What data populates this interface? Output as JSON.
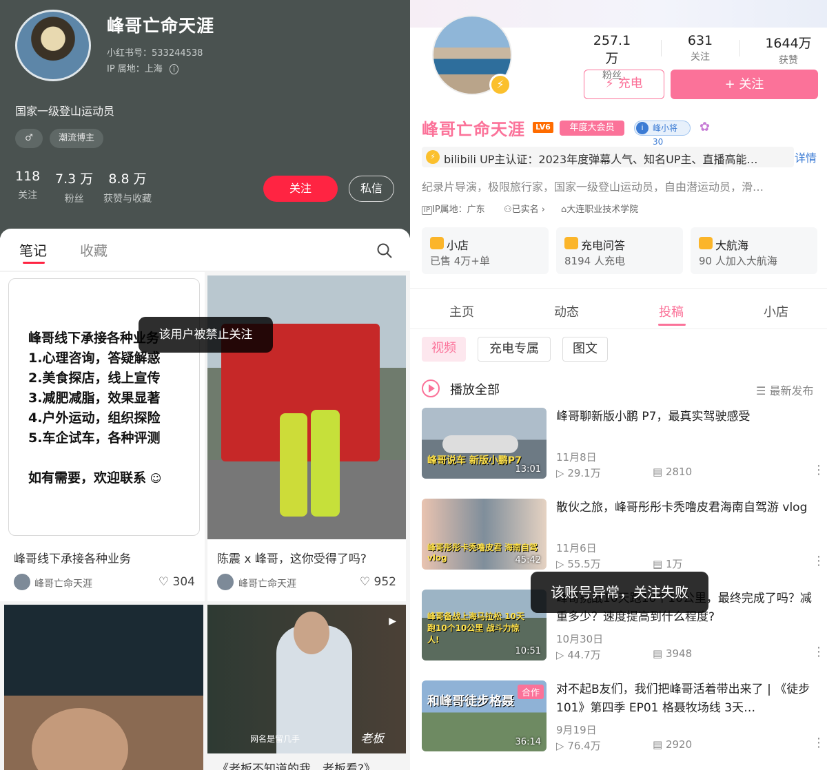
{
  "left": {
    "profile": {
      "name": "峰哥亡命天涯",
      "id_line": "小红书号：533244538",
      "ip_line": "IP 属地：上海",
      "bio": "国家一级登山运动员",
      "tags": [
        "♂",
        "潮流博主"
      ],
      "stats": [
        {
          "value": "118",
          "label": "关注"
        },
        {
          "value": "7.3 万",
          "label": "粉丝"
        },
        {
          "value": "8.8 万",
          "label": "获赞与收藏"
        }
      ],
      "follow_label": "关注",
      "message_label": "私信"
    },
    "tabs": [
      "笔记",
      "收藏"
    ],
    "notes": [
      {
        "lines": [
          "峰哥线下承接各种业务",
          "1.心理咨询，答疑解惑",
          "2.美食探店，线上宣传",
          "3.减肥减脂，效果显著",
          "4.户外运动，组织探险",
          "5.车企试车，各种评测",
          "",
          "如有需要，欢迎联系"
        ],
        "title": "峰哥线下承接各种业务",
        "author": "峰哥亡命天涯",
        "likes": "304"
      },
      {
        "title": "陈震 x 峰哥，这你受得了吗?",
        "author": "峰哥亡命天涯",
        "likes": "952"
      }
    ],
    "image_caption_2": "网名是留几手",
    "image_caption_2b": "老板",
    "toast": "该用户被禁止关注",
    "bottom_partial_title": "《老板不知道的我，老板看?》"
  },
  "right": {
    "stats": [
      {
        "value": "257.1万",
        "label": "粉丝"
      },
      {
        "value": "631",
        "label": "关注"
      },
      {
        "value": "1644万",
        "label": "获赞"
      }
    ],
    "charge_label": "充电",
    "follow_label": "+ 关注",
    "name": "峰哥亡命天涯",
    "level": "LV6",
    "vip": "年度大会员",
    "medal": "峰小将 30",
    "cert": "bilibili UP主认证：2023年度弹幕人气、知名UP主、直播高能…",
    "cert_more": "详情",
    "bio": "纪录片导演，极限旅行家，国家一级登山运动员，自由潜运动员，滑…",
    "meta": [
      "IP属地：广东",
      "已实名",
      "大连职业技术学院"
    ],
    "boxes": [
      {
        "title": "小店",
        "sub": "已售 4万+单"
      },
      {
        "title": "充电问答",
        "sub": "8194 人充电"
      },
      {
        "title": "大航海",
        "sub": "90 人加入大航海"
      }
    ],
    "tabs": [
      "主页",
      "动态",
      "投稿",
      "小店"
    ],
    "chips": [
      "视频",
      "充电专属",
      "图文"
    ],
    "play_all": "播放全部",
    "sort": "最新发布",
    "videos": [
      {
        "title": "峰哥聊新版小鹏 P7，最真实驾驶感受",
        "date": "11月8日",
        "views": "29.1万",
        "danmaku": "2810",
        "duration": "13:01",
        "overlay": "峰哥说车 新版小鹏P7"
      },
      {
        "title": "散伙之旅，峰哥彤彤卡秃噜皮君海南自驾游 vlog",
        "date": "11月6日",
        "views": "55.5万",
        "danmaku": "1万",
        "duration": "45:42",
        "overlay": "峰哥彤彤卡秃噜皮君 海南自驾vlog"
      },
      {
        "title": "峰哥挑战10天跑10个10公里，最终完成了吗？减重多少？速度提高到什么程度?",
        "date": "10月30日",
        "views": "44.7万",
        "danmaku": "3948",
        "duration": "10:51",
        "overlay": "峰哥备战上海马拉松 10天跑10个10公里 战斗力惊人!"
      },
      {
        "title": "对不起B友们，我们把峰哥活着带出来了 | 《徒步 101》第四季 EP01 格聂牧场线 3天…",
        "date": "9月19日",
        "views": "76.4万",
        "danmaku": "2920",
        "duration": "36:14",
        "overlay": "和峰哥徒步格聂",
        "badge": "合作"
      }
    ],
    "toast": "该账号异常，关注失败"
  }
}
